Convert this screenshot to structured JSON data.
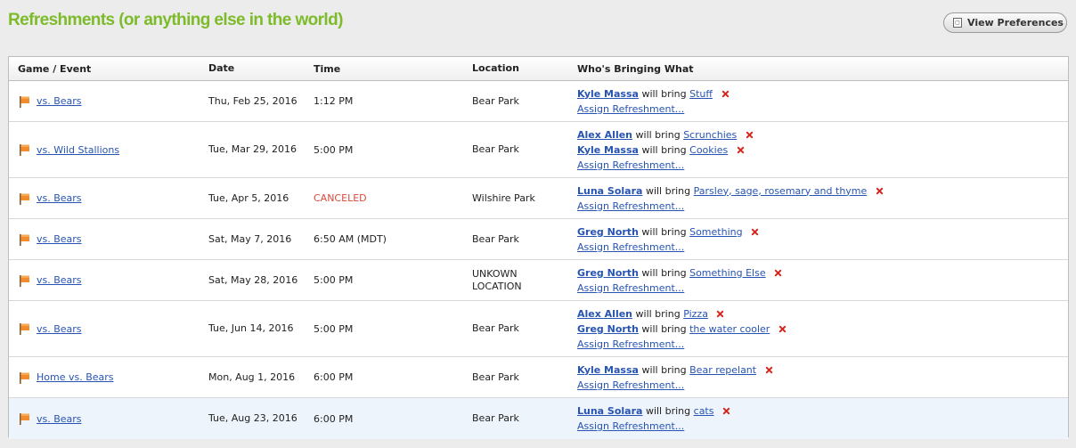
{
  "header": {
    "title": "Refreshments (or anything else in the world)",
    "prefs_label": "View Preferences"
  },
  "columns": {
    "event": "Game / Event",
    "date": "Date",
    "time": "Time",
    "location": "Location",
    "who": "Who's Bringing What"
  },
  "will_bring": "will bring",
  "assign_label": "Assign Refreshment...",
  "colors": {
    "title": "#7dbb2a",
    "link": "#2754b2",
    "canceled": "#d94a3a",
    "delete": "#d8241b",
    "flag": "#f28b2c"
  },
  "rows": [
    {
      "event": "vs. Bears",
      "date": "Thu, Feb 25, 2016",
      "time": "1:12 PM",
      "location": "Bear Park",
      "items": [
        {
          "person": "Kyle Massa",
          "item": "Stuff"
        }
      ]
    },
    {
      "event": "vs. Wild Stallions",
      "date": "Tue, Mar 29, 2016",
      "time": "5:00 PM",
      "location": "Bear Park",
      "items": [
        {
          "person": "Alex Allen",
          "item": "Scrunchies"
        },
        {
          "person": "Kyle Massa",
          "item": "Cookies"
        }
      ]
    },
    {
      "event": "vs. Bears",
      "date": "Tue, Apr 5, 2016",
      "time": "CANCELED",
      "canceled": true,
      "location": "Wilshire Park",
      "items": [
        {
          "person": "Luna Solara",
          "item": "Parsley, sage, rosemary and thyme"
        }
      ]
    },
    {
      "event": "vs. Bears",
      "date": "Sat, May 7, 2016",
      "time": "6:50 AM (MDT)",
      "location": "Bear Park",
      "items": [
        {
          "person": "Greg North",
          "item": "Something"
        }
      ]
    },
    {
      "event": "vs. Bears",
      "date": "Sat, May 28, 2016",
      "time": "5:00 PM",
      "location": "UNKOWN LOCATION",
      "items": [
        {
          "person": "Greg North",
          "item": "Something Else"
        }
      ]
    },
    {
      "event": "vs. Bears",
      "date": "Tue, Jun 14, 2016",
      "time": "5:00 PM",
      "location": "Bear Park",
      "items": [
        {
          "person": "Alex Allen",
          "item": "Pizza"
        },
        {
          "person": "Greg North",
          "item": "the water cooler"
        }
      ]
    },
    {
      "event": "Home vs. Bears",
      "date": "Mon, Aug 1, 2016",
      "time": "6:00 PM",
      "location": "Bear Park",
      "items": [
        {
          "person": "Kyle Massa",
          "item": "Bear repelant"
        }
      ]
    },
    {
      "event": "vs. Bears",
      "date": "Tue, Aug 23, 2016",
      "time": "6:00 PM",
      "location": "Bear Park",
      "items": [
        {
          "person": "Luna Solara",
          "item": "cats"
        }
      ]
    }
  ]
}
